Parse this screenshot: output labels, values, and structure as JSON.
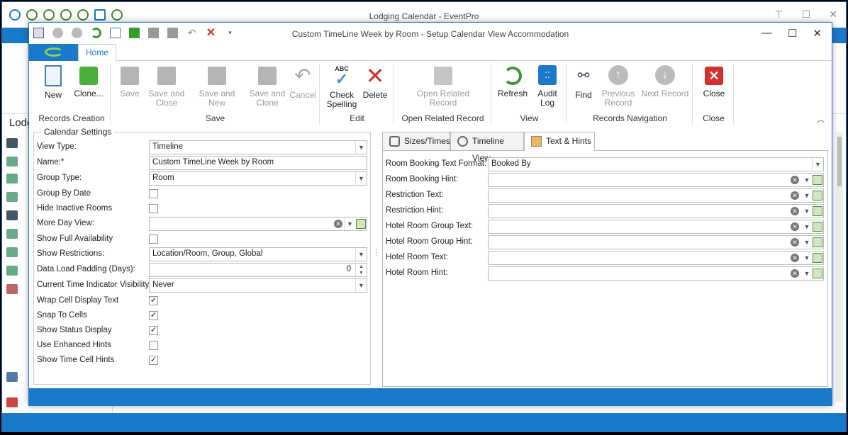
{
  "outer_window": {
    "title": "Lodging Calendar - EventPro",
    "sidebar_title": "Lodg"
  },
  "dialog": {
    "title": "Custom TimeLine Week by Room - Setup Calendar View Accommodation",
    "home_tab": "Home"
  },
  "ribbon": {
    "groups": {
      "records_creation": "Records Creation",
      "save": "Save",
      "edit": "Edit",
      "open_related": "Open Related Record",
      "view": "View",
      "records_navigation": "Records Navigation",
      "close": "Close"
    },
    "buttons": {
      "new": "New",
      "clone": "Clone...",
      "save": "Save",
      "save_and_close": "Save and Close",
      "save_and_new": "Save and New",
      "save_and_clone": "Save and Clone",
      "cancel": "Cancel",
      "check_spelling": "Check Spelling",
      "delete": "Delete",
      "open_related_record": "Open Related Record",
      "refresh": "Refresh",
      "audit_log": "Audit Log",
      "find": "Find",
      "previous_record": "Previous Record",
      "next_record": "Next Record",
      "close": "Close"
    }
  },
  "calendar_settings": {
    "legend": "Calendar Settings",
    "view_type": {
      "label": "View Type:",
      "value": "Timeline"
    },
    "name": {
      "label": "Name:*",
      "value": "Custom TimeLine Week by Room"
    },
    "group_type": {
      "label": "Group Type:",
      "value": "Room"
    },
    "group_by_date": {
      "label": "Group By Date",
      "checked": false
    },
    "hide_inactive_rooms": {
      "label": "Hide Inactive Rooms",
      "checked": false
    },
    "more_day_view": {
      "label": "More Day View:",
      "value": ""
    },
    "show_full_availability": {
      "label": "Show Full Availability",
      "checked": false
    },
    "show_restrictions": {
      "label": "Show Restrictions:",
      "value": "Location/Room, Group, Global"
    },
    "data_load_padding": {
      "label": "Data Load Padding (Days):",
      "value": "0"
    },
    "current_time_indicator": {
      "label": "Current Time Indicator Visibility:",
      "value": "Never"
    },
    "wrap_cell_display_text": {
      "label": "Wrap Cell Display Text",
      "checked": true
    },
    "snap_to_cells": {
      "label": "Snap To Cells",
      "checked": true
    },
    "show_status_display": {
      "label": "Show Status Display",
      "checked": true
    },
    "use_enhanced_hints": {
      "label": "Use Enhanced Hints",
      "checked": false
    },
    "show_time_cell_hints": {
      "label": "Show Time Cell Hints",
      "checked": true
    }
  },
  "tabs": {
    "sizes_times": "Sizes/Times",
    "timeline_view": "Timeline View",
    "text_hints": "Text & Hints"
  },
  "text_hints": {
    "room_booking_text_format": {
      "label": "Room Booking Text Format:",
      "value": "Booked By"
    },
    "room_booking_hint": {
      "label": "Room Booking Hint:",
      "value": ""
    },
    "restriction_text": {
      "label": "Restriction Text:",
      "value": ""
    },
    "restriction_hint": {
      "label": "Restriction Hint:",
      "value": ""
    },
    "hotel_room_group_text": {
      "label": "Hotel Room Group Text:",
      "value": ""
    },
    "hotel_room_group_hint": {
      "label": "Hotel Room Group Hint:",
      "value": ""
    },
    "hotel_room_text": {
      "label": "Hotel Room Text:",
      "value": ""
    },
    "hotel_room_hint": {
      "label": "Hotel Room Hint:",
      "value": ""
    }
  },
  "colors": {
    "accent": "#1979ca",
    "delete_red": "#d32f2f",
    "refresh_green": "#3b9a2e"
  }
}
